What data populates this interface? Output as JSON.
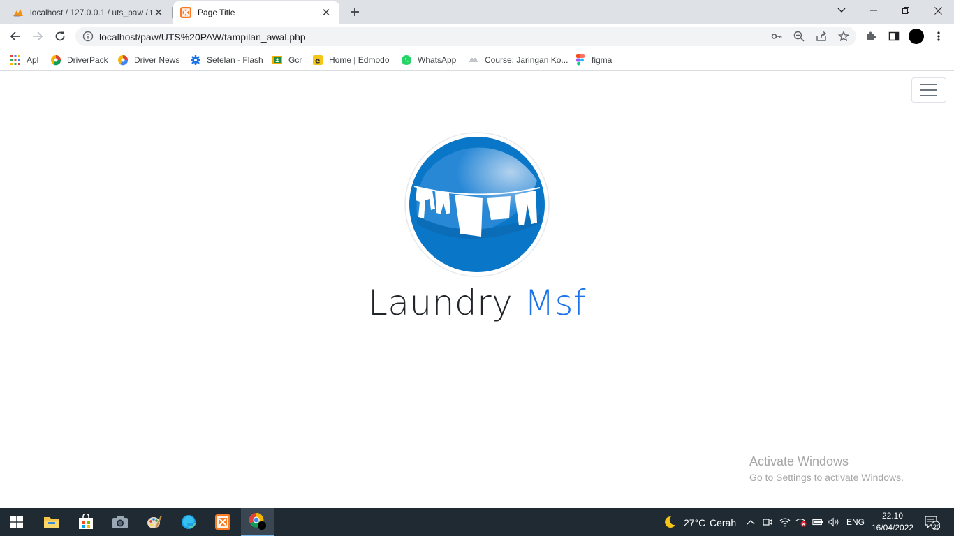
{
  "browser": {
    "tabs": [
      {
        "title": "localhost / 127.0.0.1 / uts_paw / t",
        "favicon": "phpmyadmin-icon",
        "active": false
      },
      {
        "title": "Page Title",
        "favicon": "xampp-icon",
        "active": true
      }
    ],
    "url": "localhost/paw/UTS%20PAW/tampilan_awal.php",
    "bookmarks": [
      {
        "label": "Apl",
        "icon": "apps-grid-icon"
      },
      {
        "label": "DriverPack",
        "icon": "driverpack-icon"
      },
      {
        "label": "Driver News",
        "icon": "driver-news-icon"
      },
      {
        "label": "Setelan - Flash",
        "icon": "gear-icon"
      },
      {
        "label": "Gcr",
        "icon": "classroom-icon"
      },
      {
        "label": "Home | Edmodo",
        "icon": "edmodo-icon"
      },
      {
        "label": "WhatsApp",
        "icon": "whatsapp-icon"
      },
      {
        "label": "Course: Jaringan Ko...",
        "icon": "cisco-icon"
      },
      {
        "label": "figma",
        "icon": "figma-icon"
      }
    ]
  },
  "page": {
    "brand_main": "Laundry",
    "brand_accent": "Msf",
    "logo_icon": "laundry-clothesline-icon",
    "menu_icon": "hamburger-menu-icon",
    "accent_color": "#1a73e8"
  },
  "watermark": {
    "title": "Activate Windows",
    "subtitle": "Go to Settings to activate Windows."
  },
  "taskbar": {
    "weather_temp": "27°C",
    "weather_text": "Cerah",
    "language": "ENG",
    "time": "22.10",
    "date": "16/04/2022",
    "notification_count": "20"
  }
}
